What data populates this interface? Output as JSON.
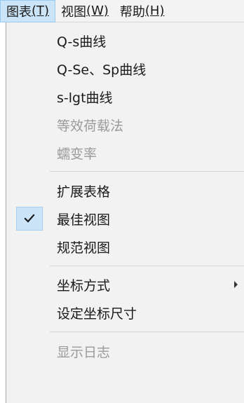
{
  "menubar": {
    "items": [
      {
        "label": "图表",
        "mnemonic": "(T)",
        "active": true
      },
      {
        "label": "视图",
        "mnemonic": "(W)",
        "active": false
      },
      {
        "label": "帮助",
        "mnemonic": "(H)",
        "active": false
      }
    ]
  },
  "dropdown": {
    "items": [
      {
        "label": "Q-s曲线",
        "enabled": true
      },
      {
        "label": "Q-Se、Sp曲线",
        "enabled": true
      },
      {
        "label": "s-lgt曲线",
        "enabled": true
      },
      {
        "label": "等效荷载法",
        "enabled": false
      },
      {
        "label": "蠕变率",
        "enabled": false
      },
      {
        "label": "扩展表格",
        "enabled": true
      },
      {
        "label": "最佳视图",
        "enabled": true,
        "checked": true
      },
      {
        "label": "规范视图",
        "enabled": true
      },
      {
        "label": "坐标方式",
        "enabled": true,
        "submenu": true
      },
      {
        "label": "设定坐标尺寸",
        "enabled": true
      },
      {
        "label": "显示日志",
        "enabled": false
      }
    ]
  },
  "icons": {
    "check": "check-icon",
    "submenu_arrow": "chevron-right-icon"
  },
  "colors": {
    "highlight": "#cce4f7",
    "highlight_border": "#99c9ef",
    "disabled_text": "#9a9a9a"
  }
}
